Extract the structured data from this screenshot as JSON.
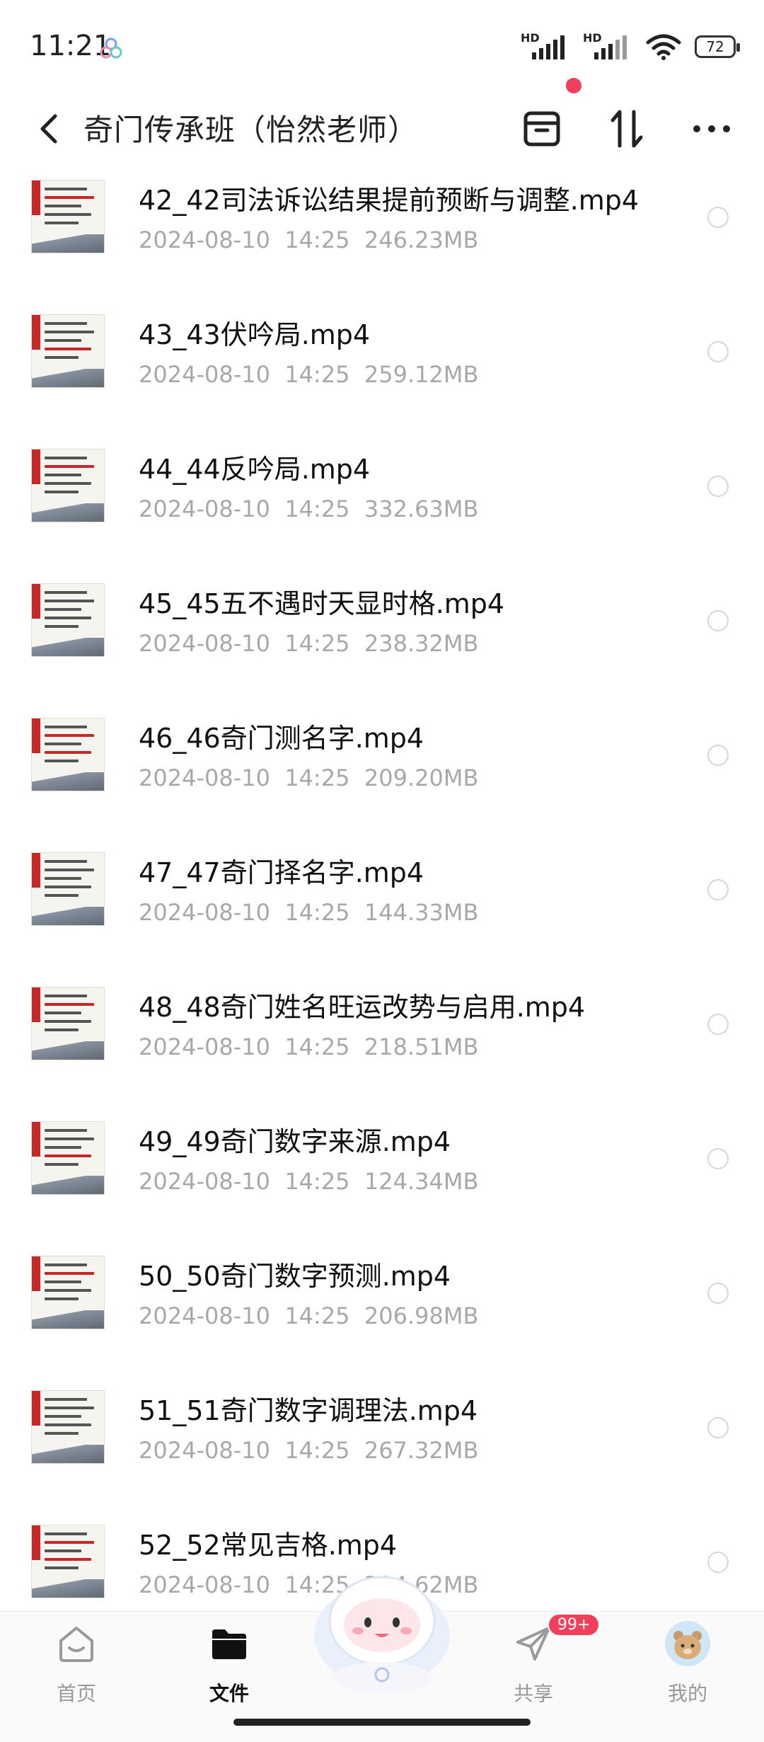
{
  "status": {
    "time": "11:21",
    "signal1_label": "HD",
    "signal2_label": "HD",
    "battery": "72"
  },
  "header": {
    "title": "奇门传承班（怡然老师）"
  },
  "files": [
    {
      "name": "42_42司法诉讼结果提前预断与调整.mp4",
      "meta": "2024-08-10  14:25  246.23MB"
    },
    {
      "name": "43_43伏吟局.mp4",
      "meta": "2024-08-10  14:25  259.12MB"
    },
    {
      "name": "44_44反吟局.mp4",
      "meta": "2024-08-10  14:25  332.63MB"
    },
    {
      "name": "45_45五不遇时天显时格.mp4",
      "meta": "2024-08-10  14:25  238.32MB"
    },
    {
      "name": "46_46奇门测名字.mp4",
      "meta": "2024-08-10  14:25  209.20MB"
    },
    {
      "name": "47_47奇门择名字.mp4",
      "meta": "2024-08-10  14:25  144.33MB"
    },
    {
      "name": "48_48奇门姓名旺运改势与启用.mp4",
      "meta": "2024-08-10  14:25  218.51MB"
    },
    {
      "name": "49_49奇门数字来源.mp4",
      "meta": "2024-08-10  14:25  124.34MB"
    },
    {
      "name": "50_50奇门数字预测.mp4",
      "meta": "2024-08-10  14:25  206.98MB"
    },
    {
      "name": "51_51奇门数字调理法.mp4",
      "meta": "2024-08-10  14:25  267.32MB"
    },
    {
      "name": "52_52常见吉格.mp4",
      "meta": "2024-08-10  14:25  294.62MB"
    }
  ],
  "nav": {
    "home": "首页",
    "files": "文件",
    "share": "共享",
    "share_badge": "99+",
    "mine": "我的"
  },
  "icons": {
    "back": "chevron-left-icon",
    "box": "archive-box-icon",
    "sort": "sort-arrows-icon",
    "more": "more-dots-icon"
  },
  "colors": {
    "accent_red": "#f0405b",
    "meta_gray": "#a8a8a8"
  }
}
